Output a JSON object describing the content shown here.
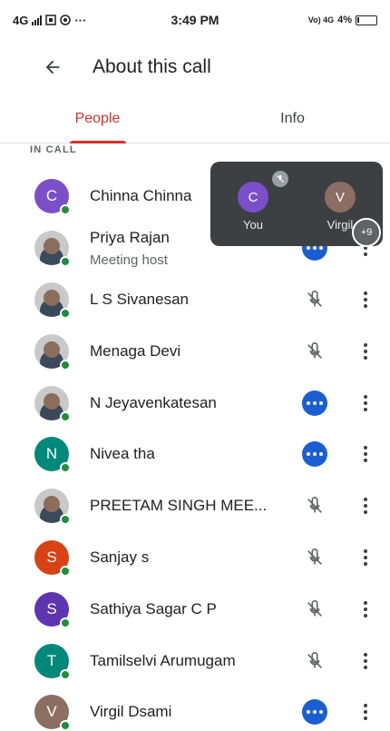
{
  "status_bar": {
    "network": "4G",
    "extra_icons": "···",
    "time": "3:49 PM",
    "volte": "Vo) 4G",
    "battery": "4%"
  },
  "header": {
    "title": "About this call"
  },
  "tabs": [
    {
      "label": "People",
      "active": true
    },
    {
      "label": "Info",
      "active": false
    }
  ],
  "section_label": "IN CALL",
  "accent_color": "#d93025",
  "participants": [
    {
      "name": "Chinna Chinna",
      "initial": "C",
      "avatar_color": "#7b4fc9",
      "photo": false,
      "subtitle": "",
      "status": "hidden"
    },
    {
      "name": "Priya Rajan",
      "initial": "",
      "avatar_color": "",
      "photo": true,
      "subtitle": "Meeting host",
      "status": "more"
    },
    {
      "name": "L S Sivanesan",
      "initial": "",
      "avatar_color": "",
      "photo": true,
      "subtitle": "",
      "status": "muted"
    },
    {
      "name": "Menaga Devi",
      "initial": "",
      "avatar_color": "",
      "photo": true,
      "subtitle": "",
      "status": "muted"
    },
    {
      "name": "N Jeyavenkatesan",
      "initial": "",
      "avatar_color": "",
      "photo": true,
      "subtitle": "",
      "status": "more"
    },
    {
      "name": "Nivea tha",
      "initial": "N",
      "avatar_color": "#00897b",
      "photo": false,
      "subtitle": "",
      "status": "more"
    },
    {
      "name": "PREETAM SINGH MEE...",
      "initial": "",
      "avatar_color": "",
      "photo": true,
      "subtitle": "",
      "status": "muted"
    },
    {
      "name": "Sanjay s",
      "initial": "S",
      "avatar_color": "#d84315",
      "photo": false,
      "subtitle": "",
      "status": "muted"
    },
    {
      "name": "Sathiya Sagar C P",
      "initial": "S",
      "avatar_color": "#5e35b1",
      "photo": false,
      "subtitle": "",
      "status": "muted"
    },
    {
      "name": "Tamilselvi Arumugam",
      "initial": "T",
      "avatar_color": "#00897b",
      "photo": false,
      "subtitle": "",
      "status": "muted"
    },
    {
      "name": "Virgil Dsami",
      "initial": "V",
      "avatar_color": "#8d6e63",
      "photo": false,
      "subtitle": "",
      "status": "more"
    }
  ],
  "pip": {
    "tiles": [
      {
        "initial": "C",
        "label": "You",
        "color": "#7b4fc9"
      },
      {
        "initial": "V",
        "label": "Virgil",
        "color": "#8d6e63"
      }
    ],
    "extra_count": "+9"
  }
}
